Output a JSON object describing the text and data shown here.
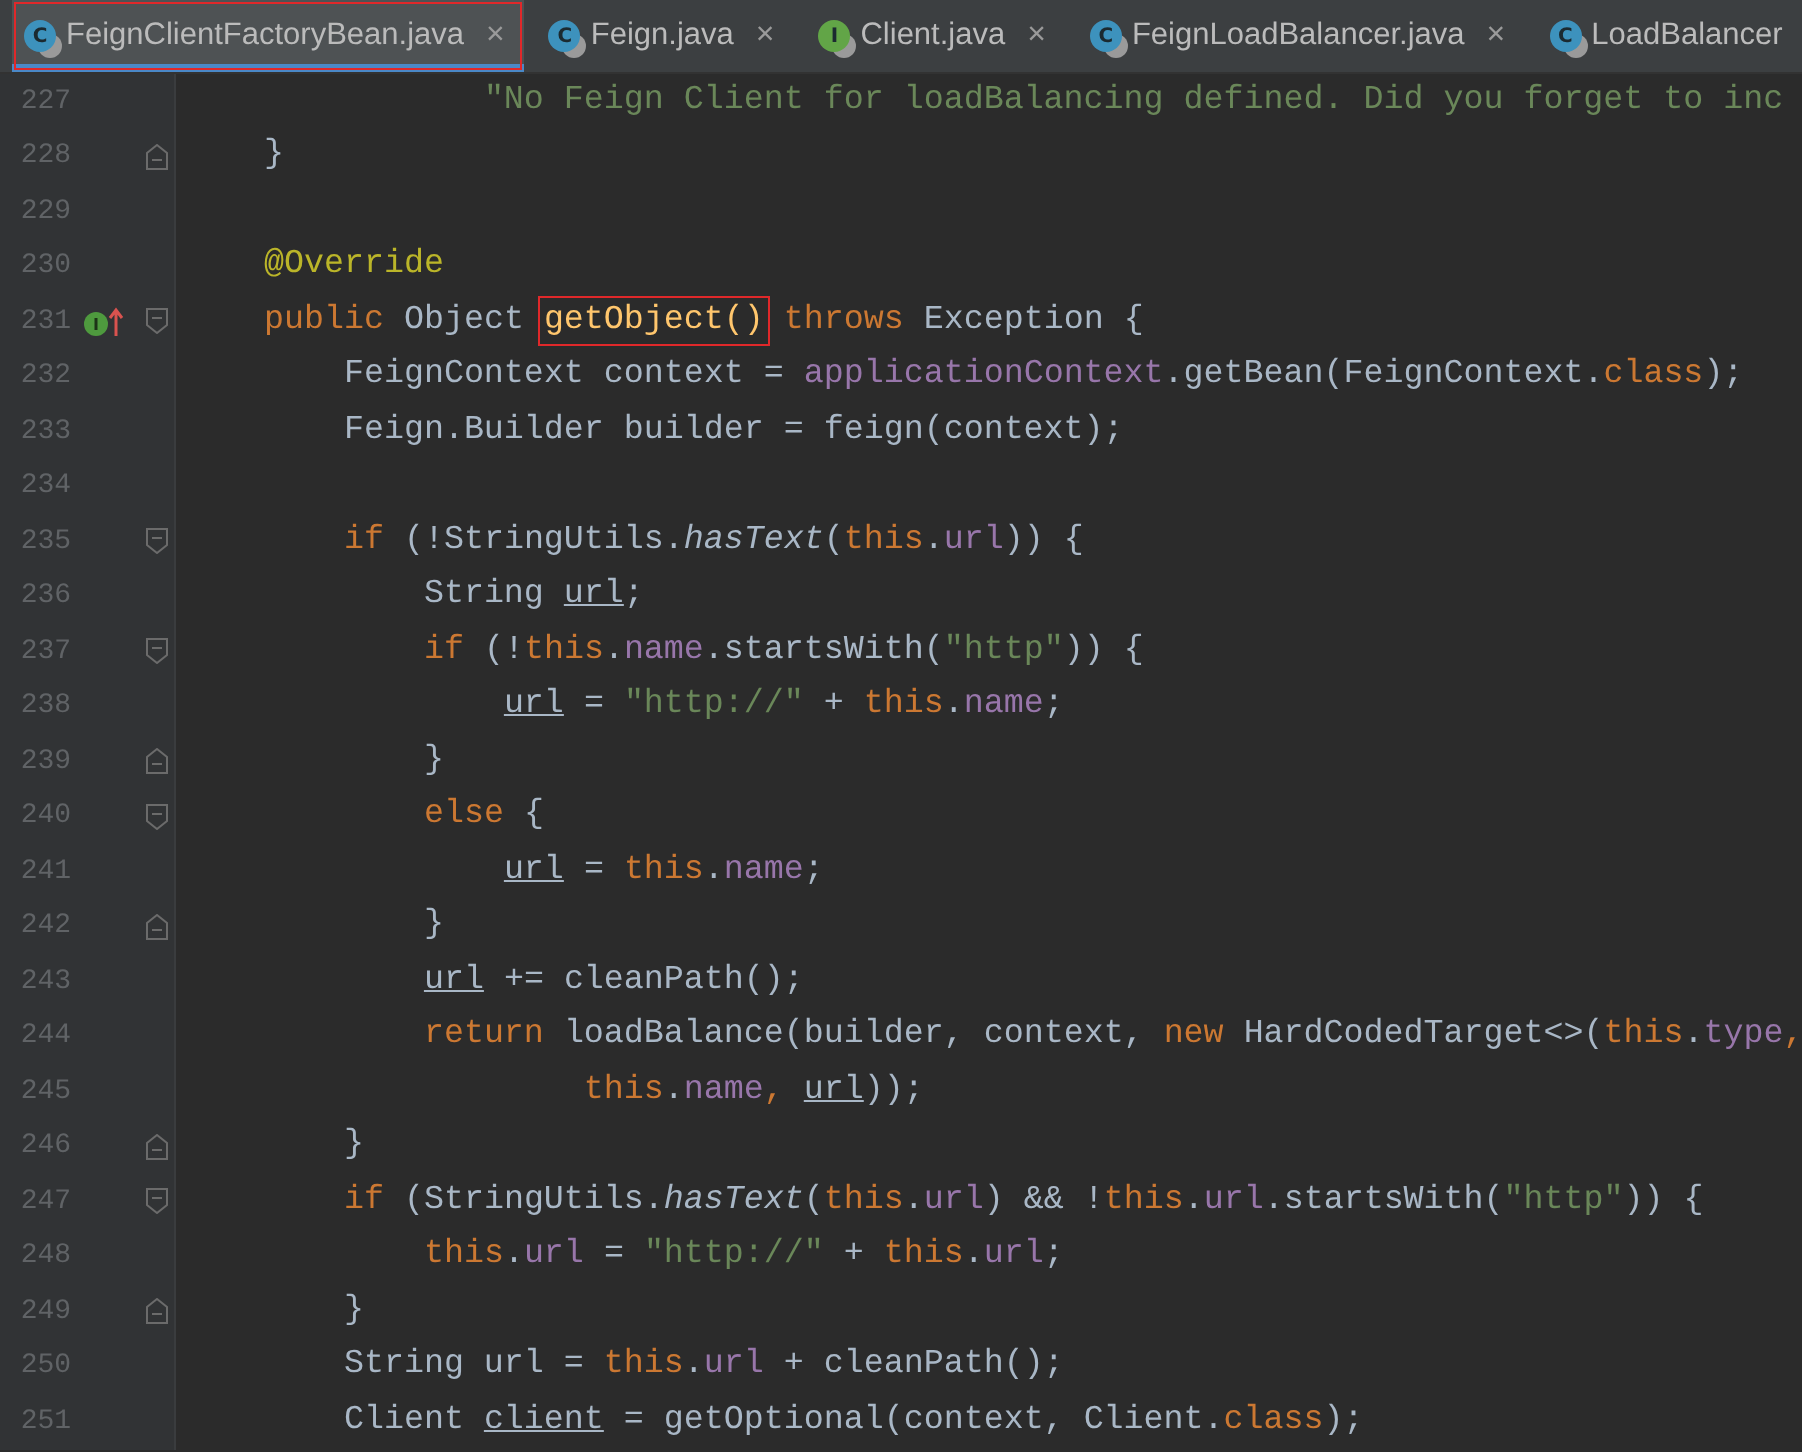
{
  "tabs": [
    {
      "label": "FeignClientFactoryBean.java",
      "kind": "class",
      "badge": "C",
      "close": "×",
      "selected": true,
      "boxed": true
    },
    {
      "label": "Feign.java",
      "kind": "class",
      "badge": "C",
      "close": "×",
      "selected": false,
      "boxed": false
    },
    {
      "label": "Client.java",
      "kind": "interface",
      "badge": "I",
      "close": "×",
      "selected": false,
      "boxed": false
    },
    {
      "label": "FeignLoadBalancer.java",
      "kind": "class",
      "badge": "C",
      "close": "×",
      "selected": false,
      "boxed": false
    },
    {
      "label": "LoadBalancer",
      "kind": "class",
      "badge": "C",
      "selected": false,
      "boxed": false
    }
  ],
  "lines": [
    {
      "number": "227",
      "fold_open": false,
      "fold_close": false,
      "marked": false,
      "tokens": [
        {
          "kind": "string",
          "text": "               \"No Feign Client for loadBalancing defined. Did you forget to inc"
        }
      ]
    },
    {
      "number": "228",
      "fold_open": false,
      "fold_close": true,
      "marked": false,
      "tokens": [
        {
          "kind": "plain",
          "text": "    }"
        }
      ]
    },
    {
      "number": "229",
      "fold_open": false,
      "fold_close": false,
      "marked": false
    },
    {
      "number": "230",
      "fold_open": false,
      "fold_close": false,
      "marked": false,
      "tokens": [
        {
          "kind": "annotation",
          "text": "    @Override"
        }
      ]
    },
    {
      "number": "231",
      "fold_open": true,
      "fold_close": false,
      "marked": true,
      "tokens": [
        {
          "kind": "keyword",
          "text": "    public"
        },
        {
          "kind": "plain",
          "text": " Object "
        },
        {
          "kind": "method",
          "text": "getObject()",
          "boxed": true
        },
        {
          "kind": "keyword",
          "text": " throws"
        },
        {
          "kind": "plain",
          "text": " Exception {"
        }
      ]
    },
    {
      "number": "232",
      "fold_open": false,
      "fold_close": false,
      "marked": false,
      "tokens": [
        {
          "kind": "plain",
          "text": "        FeignContext context = "
        },
        {
          "kind": "field",
          "text": "applicationContext"
        },
        {
          "kind": "plain",
          "text": ".getBean(FeignContext."
        },
        {
          "kind": "keyword",
          "text": "class"
        },
        {
          "kind": "plain",
          "text": ");"
        }
      ]
    },
    {
      "number": "233",
      "fold_open": false,
      "fold_close": false,
      "marked": false,
      "tokens": [
        {
          "kind": "plain",
          "text": "        Feign.Builder builder = feign(context);"
        }
      ]
    },
    {
      "number": "234",
      "fold_open": false,
      "fold_close": false,
      "marked": false
    },
    {
      "number": "235",
      "fold_open": true,
      "fold_close": false,
      "marked": false,
      "tokens": [
        {
          "kind": "keyword",
          "text": "        if"
        },
        {
          "kind": "plain",
          "text": " (!StringUtils."
        },
        {
          "kind": "static",
          "text": "hasText"
        },
        {
          "kind": "plain",
          "text": "("
        },
        {
          "kind": "keyword",
          "text": "this"
        },
        {
          "kind": "plain",
          "text": "."
        },
        {
          "kind": "field",
          "text": "url"
        },
        {
          "kind": "plain",
          "text": ")) {"
        }
      ]
    },
    {
      "number": "236",
      "fold_open": false,
      "fold_close": false,
      "marked": false,
      "tokens": [
        {
          "kind": "plain",
          "text": "            String "
        },
        {
          "kind": "local",
          "text": "url"
        },
        {
          "kind": "plain",
          "text": ";"
        }
      ]
    },
    {
      "number": "237",
      "fold_open": true,
      "fold_close": false,
      "marked": false,
      "tokens": [
        {
          "kind": "keyword",
          "text": "            if"
        },
        {
          "kind": "plain",
          "text": " (!"
        },
        {
          "kind": "keyword",
          "text": "this"
        },
        {
          "kind": "plain",
          "text": "."
        },
        {
          "kind": "field",
          "text": "name"
        },
        {
          "kind": "plain",
          "text": ".startsWith("
        },
        {
          "kind": "string",
          "text": "\"http\""
        },
        {
          "kind": "plain",
          "text": ")) {"
        }
      ]
    },
    {
      "number": "238",
      "fold_open": false,
      "fold_close": false,
      "marked": false,
      "tokens": [
        {
          "kind": "local",
          "text": "                url"
        },
        {
          "kind": "plain",
          "text": " = "
        },
        {
          "kind": "string",
          "text": "\"http://\""
        },
        {
          "kind": "plain",
          "text": " + "
        },
        {
          "kind": "keyword",
          "text": "this"
        },
        {
          "kind": "plain",
          "text": "."
        },
        {
          "kind": "field",
          "text": "name"
        },
        {
          "kind": "plain",
          "text": ";"
        }
      ]
    },
    {
      "number": "239",
      "fold_open": false,
      "fold_close": true,
      "marked": false,
      "tokens": [
        {
          "kind": "plain",
          "text": "            }"
        }
      ]
    },
    {
      "number": "240",
      "fold_open": true,
      "fold_close": false,
      "marked": false,
      "tokens": [
        {
          "kind": "keyword",
          "text": "            else"
        },
        {
          "kind": "plain",
          "text": " {"
        }
      ]
    },
    {
      "number": "241",
      "fold_open": false,
      "fold_close": false,
      "marked": false,
      "tokens": [
        {
          "kind": "local",
          "text": "                url"
        },
        {
          "kind": "plain",
          "text": " = "
        },
        {
          "kind": "keyword",
          "text": "this"
        },
        {
          "kind": "plain",
          "text": "."
        },
        {
          "kind": "field",
          "text": "name"
        },
        {
          "kind": "plain",
          "text": ";"
        }
      ]
    },
    {
      "number": "242",
      "fold_open": false,
      "fold_close": true,
      "marked": false,
      "tokens": [
        {
          "kind": "plain",
          "text": "            }"
        }
      ]
    },
    {
      "number": "243",
      "fold_open": false,
      "fold_close": false,
      "marked": false,
      "tokens": [
        {
          "kind": "local",
          "text": "            url"
        },
        {
          "kind": "plain",
          "text": " += cleanPath();"
        }
      ]
    },
    {
      "number": "244",
      "fold_open": false,
      "fold_close": false,
      "marked": false,
      "tokens": [
        {
          "kind": "keyword",
          "text": "            return"
        },
        {
          "kind": "plain",
          "text": " loadBalance(builder, context, "
        },
        {
          "kind": "keyword",
          "text": "new"
        },
        {
          "kind": "plain",
          "text": " HardCodedTarget<>("
        },
        {
          "kind": "keyword",
          "text": "this"
        },
        {
          "kind": "plain",
          "text": "."
        },
        {
          "kind": "field",
          "text": "type"
        },
        {
          "kind": "keyword",
          "text": ","
        }
      ]
    },
    {
      "number": "245",
      "fold_open": false,
      "fold_close": false,
      "marked": false,
      "tokens": [
        {
          "kind": "keyword",
          "text": "                    this"
        },
        {
          "kind": "plain",
          "text": "."
        },
        {
          "kind": "field",
          "text": "name"
        },
        {
          "kind": "keyword",
          "text": ","
        },
        {
          "kind": "local",
          "text": " url"
        },
        {
          "kind": "plain",
          "text": "));"
        }
      ]
    },
    {
      "number": "246",
      "fold_open": false,
      "fold_close": true,
      "marked": false,
      "tokens": [
        {
          "kind": "plain",
          "text": "        }"
        }
      ]
    },
    {
      "number": "247",
      "fold_open": true,
      "fold_close": false,
      "marked": false,
      "tokens": [
        {
          "kind": "keyword",
          "text": "        if"
        },
        {
          "kind": "plain",
          "text": " (StringUtils."
        },
        {
          "kind": "static",
          "text": "hasText"
        },
        {
          "kind": "plain",
          "text": "("
        },
        {
          "kind": "keyword",
          "text": "this"
        },
        {
          "kind": "plain",
          "text": "."
        },
        {
          "kind": "field",
          "text": "url"
        },
        {
          "kind": "plain",
          "text": ") && !"
        },
        {
          "kind": "keyword",
          "text": "this"
        },
        {
          "kind": "plain",
          "text": "."
        },
        {
          "kind": "field",
          "text": "url"
        },
        {
          "kind": "plain",
          "text": ".startsWith("
        },
        {
          "kind": "string",
          "text": "\"http\""
        },
        {
          "kind": "plain",
          "text": ")) {"
        }
      ]
    },
    {
      "number": "248",
      "fold_open": false,
      "fold_close": false,
      "marked": false,
      "tokens": [
        {
          "kind": "keyword",
          "text": "            this"
        },
        {
          "kind": "plain",
          "text": "."
        },
        {
          "kind": "field",
          "text": "url"
        },
        {
          "kind": "plain",
          "text": " = "
        },
        {
          "kind": "string",
          "text": "\"http://\""
        },
        {
          "kind": "plain",
          "text": " + "
        },
        {
          "kind": "keyword",
          "text": "this"
        },
        {
          "kind": "plain",
          "text": "."
        },
        {
          "kind": "field",
          "text": "url"
        },
        {
          "kind": "plain",
          "text": ";"
        }
      ]
    },
    {
      "number": "249",
      "fold_open": false,
      "fold_close": true,
      "marked": false,
      "tokens": [
        {
          "kind": "plain",
          "text": "        }"
        }
      ]
    },
    {
      "number": "250",
      "fold_open": false,
      "fold_close": false,
      "marked": false,
      "tokens": [
        {
          "kind": "plain",
          "text": "        String url = "
        },
        {
          "kind": "keyword",
          "text": "this"
        },
        {
          "kind": "plain",
          "text": "."
        },
        {
          "kind": "field",
          "text": "url"
        },
        {
          "kind": "plain",
          "text": " + cleanPath();"
        }
      ]
    },
    {
      "number": "251",
      "fold_open": false,
      "fold_close": false,
      "marked": false,
      "tokens": [
        {
          "kind": "plain",
          "text": "        Client "
        },
        {
          "kind": "local",
          "text": "client"
        },
        {
          "kind": "plain",
          "text": " = getOptional(context, Client."
        },
        {
          "kind": "keyword",
          "text": "class"
        },
        {
          "kind": "plain",
          "text": ");"
        }
      ]
    }
  ]
}
